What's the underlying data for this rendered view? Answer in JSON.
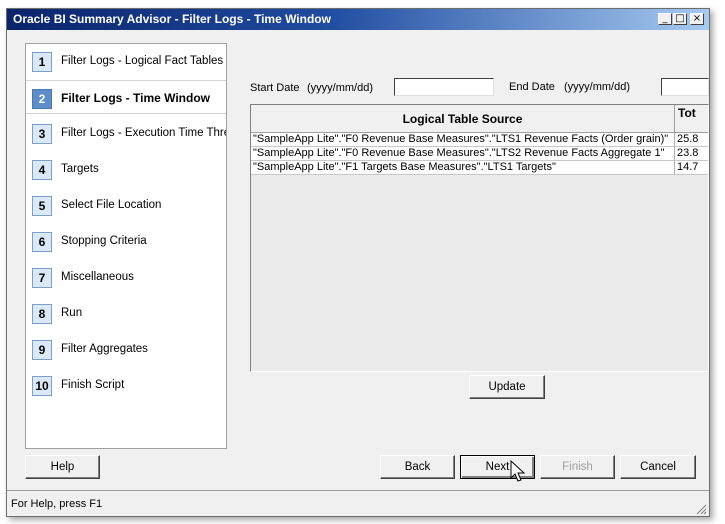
{
  "window": {
    "title": "Oracle BI Summary Advisor - Filter Logs - Time Window",
    "minimize_glyph": "_",
    "maximize_glyph": "□",
    "close_glyph": "×"
  },
  "steps": [
    {
      "num": "1",
      "label": "Filter Logs - Logical Fact Tables"
    },
    {
      "num": "2",
      "label": "Filter Logs - Time Window"
    },
    {
      "num": "3",
      "label": "Filter Logs - Execution Time Threshold"
    },
    {
      "num": "4",
      "label": "Targets"
    },
    {
      "num": "5",
      "label": "Select File Location"
    },
    {
      "num": "6",
      "label": "Stopping Criteria"
    },
    {
      "num": "7",
      "label": "Miscellaneous"
    },
    {
      "num": "8",
      "label": "Run"
    },
    {
      "num": "9",
      "label": "Filter Aggregates"
    },
    {
      "num": "10",
      "label": "Finish Script"
    }
  ],
  "active_step": 1,
  "filters": {
    "start_label": "Start Date",
    "start_format": "(yyyy/mm/dd)",
    "start_value": "",
    "end_label": "End Date",
    "end_format": "(yyyy/mm/dd)",
    "end_value": ""
  },
  "table": {
    "columns": [
      "Logical Table Source",
      "Tot"
    ],
    "rows": [
      [
        "\"SampleApp Lite\".\"F0 Revenue Base Measures\".\"LTS1 Revenue Facts (Order grain)\"",
        "25.8"
      ],
      [
        "\"SampleApp Lite\".\"F0 Revenue Base Measures\".\"LTS2 Revenue Facts Aggregate 1\"",
        "23.8"
      ],
      [
        "\"SampleApp Lite\".\"F1 Targets Base Measures\".\"LTS1 Targets\"",
        "14.7"
      ]
    ]
  },
  "buttons": {
    "update": "Update",
    "help": "Help",
    "back": "Back",
    "next": "Next",
    "finish": "Finish",
    "cancel": "Cancel"
  },
  "status": {
    "text": "For Help, press F1"
  }
}
